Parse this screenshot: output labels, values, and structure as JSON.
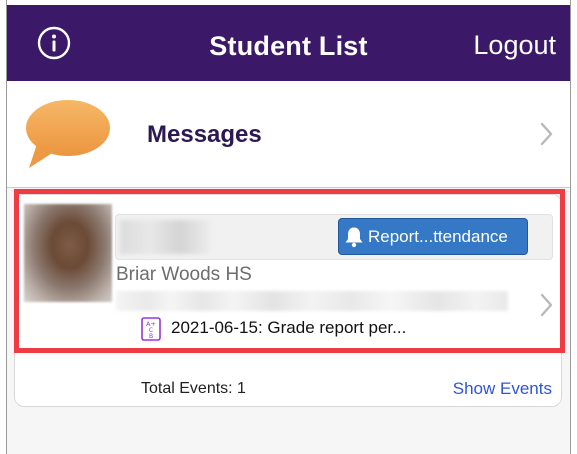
{
  "navbar": {
    "title": "Student List",
    "logout_label": "Logout",
    "info_icon": "info-circle-icon",
    "background": "#3b1868"
  },
  "messages": {
    "label": "Messages",
    "icon": "speech-bubble-icon",
    "icon_color": "#f1a24e"
  },
  "student": {
    "school": "Briar Woods HS",
    "report_badge_label": "Report...ttendance",
    "badge_color": "#3478c6",
    "event_text": "2021-06-15: Grade report per...",
    "grade_icon": "grade-report-icon",
    "highlight_color": "#ef3b43"
  },
  "footer": {
    "total_events": "Total Events: 1",
    "show_events_label": "Show Events",
    "link_color": "#2d55d6"
  }
}
